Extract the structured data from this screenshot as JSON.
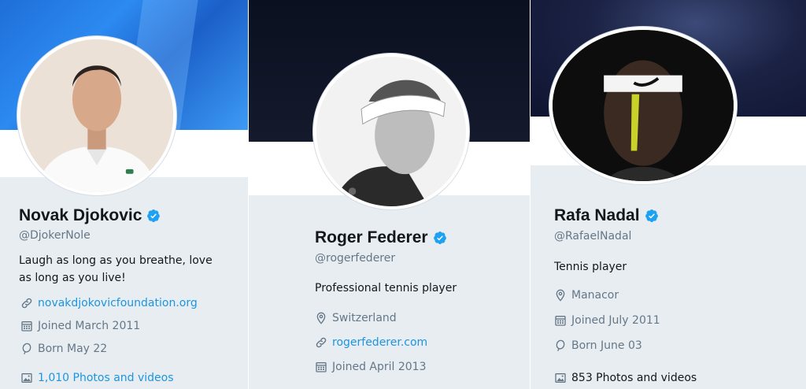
{
  "profiles": [
    {
      "name": "Novak Djokovic",
      "handle": "@DjokerNole",
      "bio": "Laugh as long as you breathe, love as long as you live!",
      "website": "novakdjokovicfoundation.org",
      "joined": "Joined March 2011",
      "born": "Born May 22",
      "photos": "1,010 Photos and videos",
      "icons": [
        "verified-badge-icon",
        "link-icon",
        "calendar-icon",
        "balloon-icon",
        "image-icon"
      ]
    },
    {
      "name": "Roger Federer",
      "handle": "@rogerfederer",
      "bio": "Professional tennis player",
      "location": "Switzerland",
      "website": "rogerfederer.com",
      "joined": "Joined April 2013",
      "icons": [
        "verified-badge-icon",
        "location-pin-icon",
        "link-icon",
        "calendar-icon"
      ]
    },
    {
      "name": "Rafa Nadal",
      "handle": "@RafaelNadal",
      "bio": "Tennis player",
      "location": "Manacor",
      "joined": "Joined July 2011",
      "born": "Born June 03",
      "photos": "853 Photos and videos",
      "icons": [
        "verified-badge-icon",
        "location-pin-icon",
        "calendar-icon",
        "balloon-icon",
        "image-icon"
      ]
    }
  ],
  "colors": {
    "verified": "#1da1f2",
    "link": "#1b95e0",
    "muted": "#657786",
    "text": "#14171a",
    "card_bg": "#e8edf2"
  }
}
